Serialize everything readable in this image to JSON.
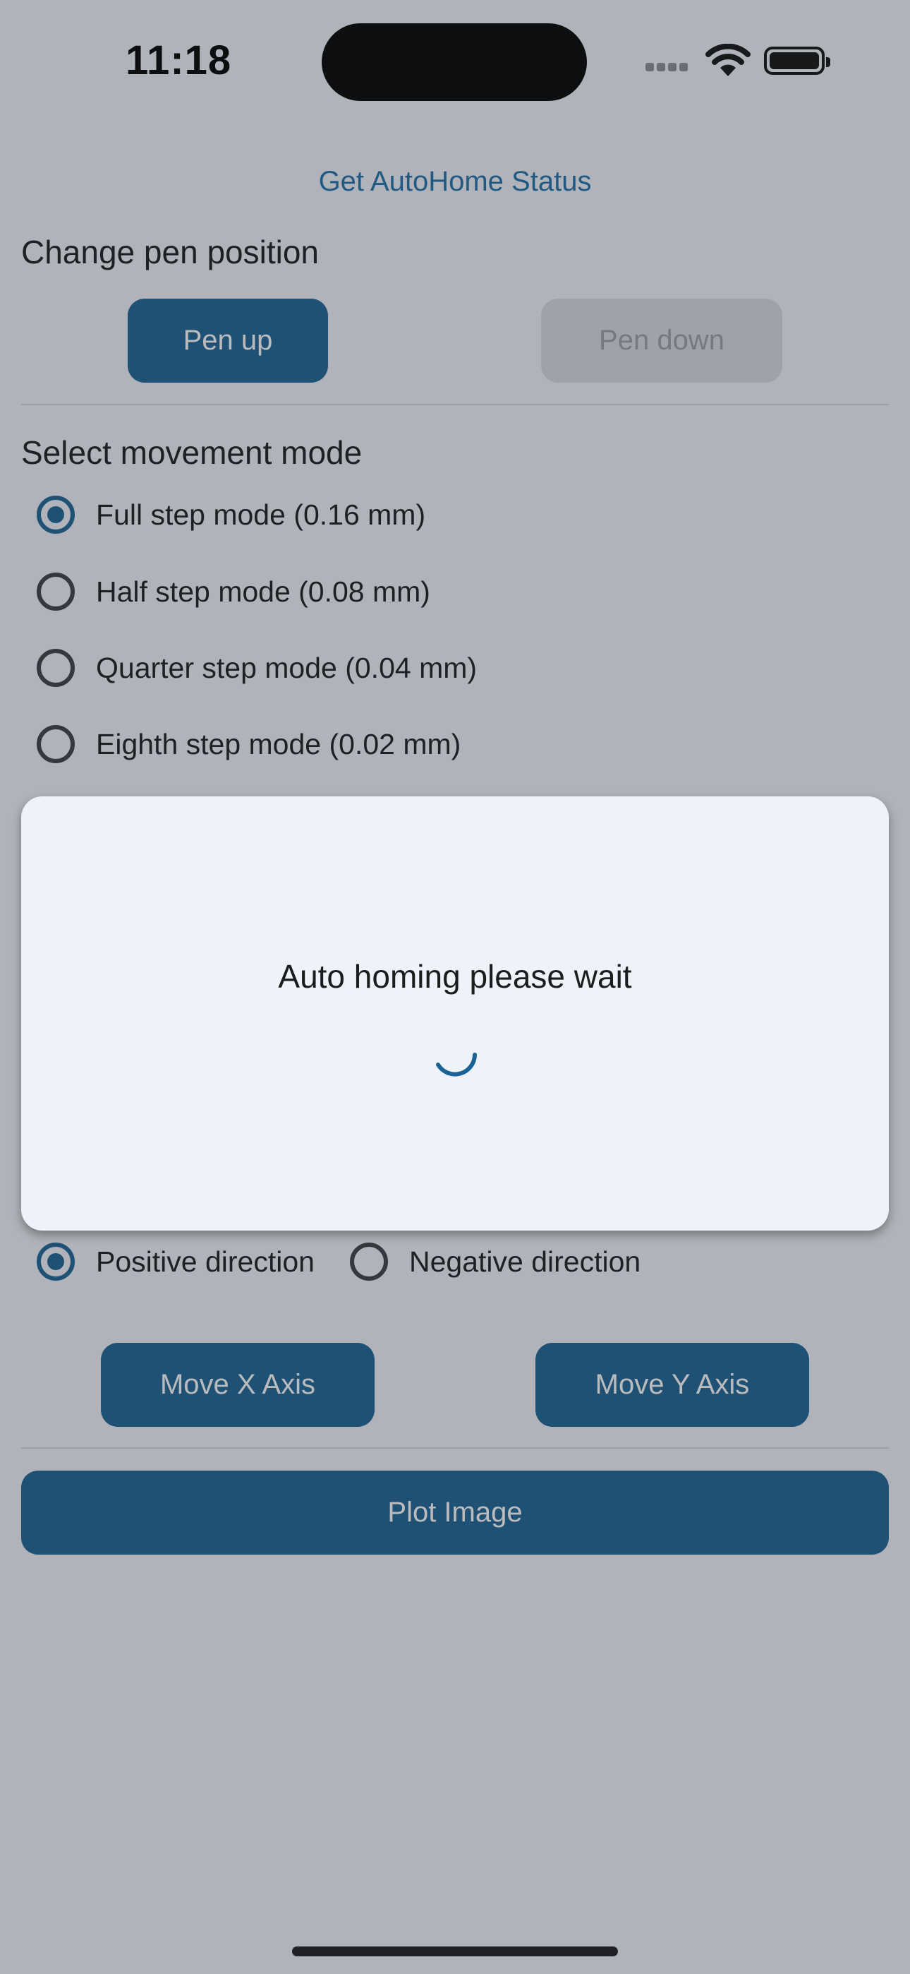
{
  "status_bar": {
    "time": "11:18"
  },
  "header": {
    "autohome_link": "Get AutoHome Status"
  },
  "pen": {
    "heading": "Change pen position",
    "pen_up_label": "Pen up",
    "pen_down_label": "Pen down"
  },
  "movement": {
    "heading": "Select movement mode",
    "options": [
      {
        "label": "Full step mode (0.16 mm)",
        "selected": true
      },
      {
        "label": "Half step mode (0.08 mm)",
        "selected": false
      },
      {
        "label": "Quarter step mode (0.04 mm)",
        "selected": false
      },
      {
        "label": "Eighth step mode (0.02 mm)",
        "selected": false
      }
    ]
  },
  "direction": {
    "positive_label": "Positive direction",
    "negative_label": "Negative direction",
    "selected": "positive"
  },
  "axis": {
    "move_x_label": "Move X Axis",
    "move_y_label": "Move Y Axis"
  },
  "plot": {
    "plot_image_label": "Plot Image"
  },
  "dialog": {
    "message": "Auto homing please wait"
  },
  "colors": {
    "primary": "#1b6396",
    "link": "#1e6fa8",
    "background": "#f0f4fa",
    "dialog_background": "#eef3f9"
  },
  "icons": {
    "wifi": "wifi-icon",
    "battery": "battery-icon",
    "signal": "cellular-signal-icon",
    "spinner": "loading-spinner-icon"
  }
}
